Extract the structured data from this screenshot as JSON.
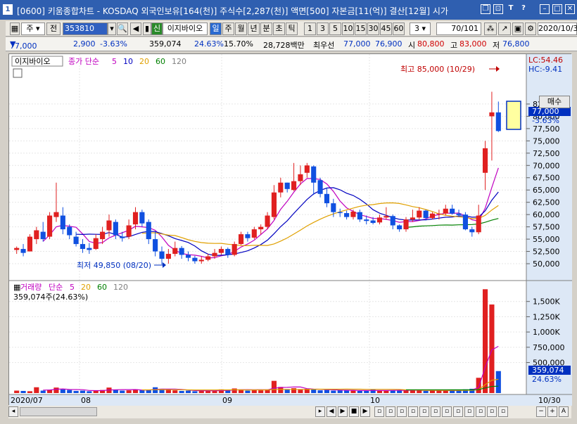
{
  "titlebar": {
    "num": "1",
    "title": "[0600] 키움종합차트 - KOSDAQ 외국인보유[164(천)] 주식수[2,287(천)] 액면[500] 자본금[11(억)] 결산[12월] 시가",
    "icons": [
      "restore-icon",
      "pin-icon",
      "T",
      "?",
      "minimize-icon",
      "maximize-icon",
      "close-icon"
    ]
  },
  "toolbar1": {
    "period_sel": "주",
    "prev_label": "전",
    "code": "353810",
    "new_badge": "신",
    "stock_name": "이지바이오",
    "tabs": [
      "일",
      "주",
      "월",
      "년",
      "분",
      "초",
      "틱"
    ],
    "active_tab": "일",
    "periods": [
      "1",
      "3",
      "5",
      "10",
      "15",
      "30",
      "45",
      "60"
    ],
    "tick_sel": "3",
    "count": "70/101",
    "date": "2020/10/3"
  },
  "quote": {
    "price": "77,000",
    "change": "2,900",
    "change_pct": "-3.63%",
    "volume": "359,074",
    "vol_pct": "24.63%",
    "turnover_pct": "15.70%",
    "amount": "28,728백만",
    "best_bid_label": "최우선",
    "best_ask": "77,000",
    "best_bid": "76,900",
    "open_label": "시",
    "open": "80,800",
    "high_label": "고",
    "high": "83,000",
    "low_label": "저",
    "low": "76,800"
  },
  "chart_legend": {
    "name": "이지바이오",
    "ma_label": "종가 단순",
    "ma_periods": [
      "5",
      "10",
      "20",
      "60",
      "120"
    ],
    "ma_colors": [
      "#c000c0",
      "#0000c0",
      "#e0a000",
      "#008000",
      "#808080"
    ]
  },
  "price_axis": {
    "ticks": [
      "82,500",
      "80,000",
      "77,500",
      "75,000",
      "72,500",
      "70,000",
      "67,500",
      "65,000",
      "62,500",
      "60,000",
      "57,500",
      "55,000",
      "52,500",
      "50,000"
    ],
    "lc": "LC:54.46",
    "hc": "HC:-9.41",
    "current": "77,000",
    "current_pct": "-3.63%"
  },
  "annotations": {
    "high": "최고 85,000 (10/29)",
    "low": "최저 49,850 (08/20)"
  },
  "volume_legend": {
    "name": "거래량",
    "ma_label": "단순",
    "ma_periods": [
      "5",
      "20",
      "60",
      "120"
    ],
    "current": "359,074주(24.63%)"
  },
  "volume_axis": {
    "ticks": [
      "1,500K",
      "1,250K",
      "1,000K",
      "750,000",
      "500,000"
    ],
    "current": "359,074",
    "current_pct": "24.63%"
  },
  "date_axis": {
    "labels": [
      "2020/07",
      "08",
      "09",
      "10",
      "10/30"
    ]
  },
  "side_button": "매수",
  "chart_data": {
    "type": "candlestick",
    "candles": [
      {
        "o": 52800,
        "h": 53500,
        "l": 52000,
        "c": 53200
      },
      {
        "o": 53000,
        "h": 54000,
        "l": 51500,
        "c": 52200
      },
      {
        "o": 52500,
        "h": 56000,
        "l": 52500,
        "c": 55500
      },
      {
        "o": 55000,
        "h": 57500,
        "l": 54000,
        "c": 56800
      },
      {
        "o": 56500,
        "h": 58500,
        "l": 54500,
        "c": 55000
      },
      {
        "o": 55500,
        "h": 60500,
        "l": 55000,
        "c": 59800
      },
      {
        "o": 59500,
        "h": 66500,
        "l": 58500,
        "c": 60500
      },
      {
        "o": 59800,
        "h": 61500,
        "l": 56000,
        "c": 57000
      },
      {
        "o": 57500,
        "h": 58000,
        "l": 55000,
        "c": 55800
      },
      {
        "o": 55500,
        "h": 56500,
        "l": 53500,
        "c": 54000
      },
      {
        "o": 54000,
        "h": 55000,
        "l": 52200,
        "c": 53000
      },
      {
        "o": 53200,
        "h": 54200,
        "l": 52000,
        "c": 52800
      },
      {
        "o": 53000,
        "h": 56000,
        "l": 52800,
        "c": 55200
      },
      {
        "o": 55000,
        "h": 57500,
        "l": 54000,
        "c": 56500
      },
      {
        "o": 56800,
        "h": 60000,
        "l": 55500,
        "c": 58800
      },
      {
        "o": 58500,
        "h": 59000,
        "l": 55000,
        "c": 55800
      },
      {
        "o": 55500,
        "h": 56500,
        "l": 54500,
        "c": 55200
      },
      {
        "o": 55500,
        "h": 59000,
        "l": 55000,
        "c": 57800
      },
      {
        "o": 58000,
        "h": 61500,
        "l": 57000,
        "c": 60500
      },
      {
        "o": 60500,
        "h": 61000,
        "l": 57500,
        "c": 58200
      },
      {
        "o": 58500,
        "h": 59000,
        "l": 54000,
        "c": 55000
      },
      {
        "o": 55000,
        "h": 56500,
        "l": 51500,
        "c": 52500
      },
      {
        "o": 52500,
        "h": 53500,
        "l": 49850,
        "c": 51000
      },
      {
        "o": 51000,
        "h": 53000,
        "l": 50000,
        "c": 52000
      },
      {
        "o": 52000,
        "h": 54500,
        "l": 51500,
        "c": 53200
      },
      {
        "o": 53200,
        "h": 53600,
        "l": 51000,
        "c": 51800
      },
      {
        "o": 51800,
        "h": 52500,
        "l": 50500,
        "c": 51200
      },
      {
        "o": 51200,
        "h": 51600,
        "l": 50000,
        "c": 50500
      },
      {
        "o": 50500,
        "h": 51500,
        "l": 50000,
        "c": 50800
      },
      {
        "o": 50800,
        "h": 52000,
        "l": 50500,
        "c": 51500
      },
      {
        "o": 51500,
        "h": 53000,
        "l": 51000,
        "c": 52200
      },
      {
        "o": 52200,
        "h": 53500,
        "l": 51800,
        "c": 53000
      },
      {
        "o": 53000,
        "h": 53300,
        "l": 51200,
        "c": 51800
      },
      {
        "o": 51800,
        "h": 54500,
        "l": 51500,
        "c": 54000
      },
      {
        "o": 54000,
        "h": 56500,
        "l": 53800,
        "c": 56000
      },
      {
        "o": 56000,
        "h": 56500,
        "l": 54500,
        "c": 55200
      },
      {
        "o": 55300,
        "h": 57500,
        "l": 55000,
        "c": 57000
      },
      {
        "o": 57000,
        "h": 58000,
        "l": 56000,
        "c": 57500
      },
      {
        "o": 57500,
        "h": 60500,
        "l": 57000,
        "c": 59800
      },
      {
        "o": 59500,
        "h": 66000,
        "l": 59000,
        "c": 64500
      },
      {
        "o": 64500,
        "h": 67500,
        "l": 63500,
        "c": 66500
      },
      {
        "o": 66500,
        "h": 66500,
        "l": 64500,
        "c": 65200
      },
      {
        "o": 65000,
        "h": 70500,
        "l": 64800,
        "c": 66800
      },
      {
        "o": 66800,
        "h": 70000,
        "l": 66000,
        "c": 68200
      },
      {
        "o": 68500,
        "h": 70500,
        "l": 67500,
        "c": 70000
      },
      {
        "o": 69800,
        "h": 70000,
        "l": 64000,
        "c": 66500
      },
      {
        "o": 67000,
        "h": 67500,
        "l": 63500,
        "c": 64200
      },
      {
        "o": 64200,
        "h": 65500,
        "l": 61500,
        "c": 62300
      },
      {
        "o": 62300,
        "h": 63200,
        "l": 59500,
        "c": 60500
      },
      {
        "o": 60500,
        "h": 61200,
        "l": 59500,
        "c": 60300
      },
      {
        "o": 60300,
        "h": 60800,
        "l": 59000,
        "c": 59500
      },
      {
        "o": 59500,
        "h": 61000,
        "l": 59000,
        "c": 60600
      },
      {
        "o": 60500,
        "h": 61000,
        "l": 58500,
        "c": 59000
      },
      {
        "o": 59000,
        "h": 59800,
        "l": 58000,
        "c": 58700
      },
      {
        "o": 58800,
        "h": 59500,
        "l": 58000,
        "c": 58300
      },
      {
        "o": 58400,
        "h": 60000,
        "l": 58000,
        "c": 59400
      },
      {
        "o": 59400,
        "h": 61500,
        "l": 59000,
        "c": 59700
      },
      {
        "o": 59700,
        "h": 60000,
        "l": 57000,
        "c": 57800
      },
      {
        "o": 57800,
        "h": 58000,
        "l": 56500,
        "c": 57000
      },
      {
        "o": 57000,
        "h": 59500,
        "l": 56500,
        "c": 59000
      },
      {
        "o": 59000,
        "h": 61000,
        "l": 58500,
        "c": 59400
      },
      {
        "o": 59400,
        "h": 61500,
        "l": 59000,
        "c": 60800
      },
      {
        "o": 60800,
        "h": 61000,
        "l": 58800,
        "c": 59300
      },
      {
        "o": 59300,
        "h": 60500,
        "l": 59000,
        "c": 60200
      },
      {
        "o": 60200,
        "h": 61000,
        "l": 59000,
        "c": 60200
      },
      {
        "o": 60200,
        "h": 62000,
        "l": 59800,
        "c": 61200
      },
      {
        "o": 61200,
        "h": 62000,
        "l": 60000,
        "c": 60200
      },
      {
        "o": 60200,
        "h": 61000,
        "l": 59500,
        "c": 59900
      },
      {
        "o": 60000,
        "h": 60500,
        "l": 56800,
        "c": 57000
      },
      {
        "o": 57000,
        "h": 57500,
        "l": 55500,
        "c": 56400
      },
      {
        "o": 56400,
        "h": 62000,
        "l": 56000,
        "c": 59800
      },
      {
        "o": 68500,
        "h": 75000,
        "l": 65000,
        "c": 73500
      },
      {
        "o": 80000,
        "h": 85000,
        "l": 71000,
        "c": 80800
      },
      {
        "o": 80800,
        "h": 83000,
        "l": 76800,
        "c": 77000
      }
    ],
    "volume": [
      40,
      35,
      30,
      95,
      40,
      55,
      90,
      60,
      50,
      35,
      40,
      30,
      45,
      50,
      90,
      55,
      40,
      45,
      60,
      45,
      55,
      95,
      70,
      55,
      45,
      35,
      40,
      30,
      45,
      40,
      35,
      60,
      40,
      75,
      60,
      40,
      55,
      45,
      60,
      200,
      100,
      60,
      80,
      55,
      70,
      60,
      45,
      50,
      40,
      45,
      50,
      40,
      35,
      35,
      55,
      40,
      45,
      45,
      40,
      50,
      50,
      45,
      35,
      40,
      45,
      50,
      40,
      40,
      60,
      70,
      250,
      1700,
      1450,
      360
    ],
    "price_range": [
      48000,
      87500
    ],
    "volume_range": [
      0,
      1750000
    ],
    "grid": true,
    "x_labels": [
      "2020/07",
      "08",
      "09",
      "10"
    ]
  }
}
